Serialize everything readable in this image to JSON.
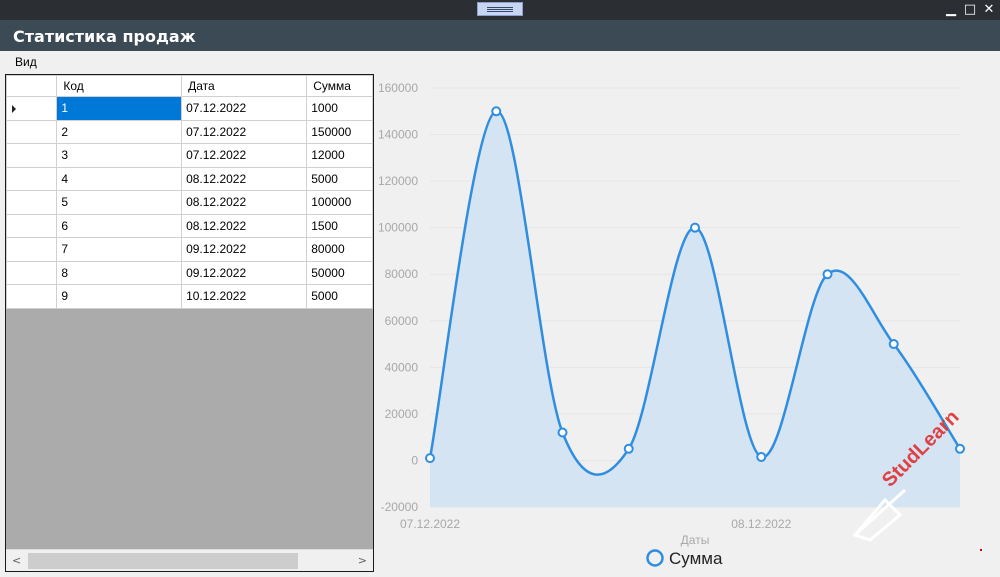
{
  "window": {
    "title": "Статистика продаж",
    "controls": {
      "minimize": "▁",
      "maximize": "□",
      "close": "✕"
    }
  },
  "menu": {
    "items": [
      {
        "label": "Вид"
      }
    ]
  },
  "grid": {
    "columns": [
      "Код",
      "Дата",
      "Сумма"
    ],
    "rows": [
      [
        "1",
        "07.12.2022",
        "1000"
      ],
      [
        "2",
        "07.12.2022",
        "150000"
      ],
      [
        "3",
        "07.12.2022",
        "12000"
      ],
      [
        "4",
        "08.12.2022",
        "5000"
      ],
      [
        "5",
        "08.12.2022",
        "100000"
      ],
      [
        "6",
        "08.12.2022",
        "1500"
      ],
      [
        "7",
        "09.12.2022",
        "80000"
      ],
      [
        "8",
        "09.12.2022",
        "50000"
      ],
      [
        "9",
        "10.12.2022",
        "5000"
      ]
    ],
    "selected_row": 0,
    "scroll": {
      "left": "<",
      "right": ">"
    }
  },
  "watermark": {
    "text": "StudLearn"
  },
  "colors": {
    "series": "#2f8ee0",
    "fill": "#cfe2f3",
    "selection": "#0078d7"
  },
  "chart_data": {
    "type": "area",
    "x": [
      1,
      2,
      3,
      4,
      5,
      6,
      7,
      8,
      9
    ],
    "x_tick_labels": [
      {
        "at": 1,
        "label": "07.12.2022"
      },
      {
        "at": 6,
        "label": "08.12.2022"
      }
    ],
    "series": [
      {
        "name": "Сумма",
        "values": [
          1000,
          150000,
          12000,
          5000,
          100000,
          1500,
          80000,
          50000,
          5000
        ]
      }
    ],
    "xlabel": "Даты",
    "ylabel": "",
    "ylim": [
      -20000,
      160000
    ],
    "yticks": [
      -20000,
      0,
      20000,
      40000,
      60000,
      80000,
      100000,
      120000,
      140000,
      160000
    ],
    "grid": true,
    "smooth": true,
    "legend": "bottom"
  }
}
